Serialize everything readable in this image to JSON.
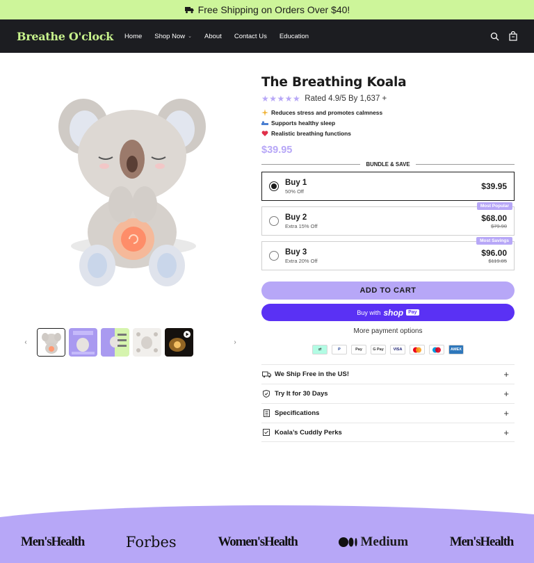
{
  "announcement": {
    "text": "Free Shipping on Orders Over $40!"
  },
  "header": {
    "logo": "Breathe O'clock",
    "nav": [
      "Home",
      "Shop Now",
      "About",
      "Contact Us",
      "Education"
    ]
  },
  "product": {
    "title": "The Breathing Koala",
    "rating_text": "Rated 4.9/5 By 1,637 +",
    "stars": "★★★★★",
    "benefits": [
      {
        "icon": "sparkle-icon",
        "text": "Reduces stress and promotes calmness"
      },
      {
        "icon": "sleep-icon",
        "text": "Supports healthy sleep"
      },
      {
        "icon": "heart-icon",
        "text": "Realistic breathing functions"
      }
    ],
    "price": "$39.95",
    "bundle_label": "BUNDLE & SAVE",
    "options": [
      {
        "title": "Buy 1",
        "subtitle": "50% Off",
        "price": "$39.95",
        "compare": "",
        "badge": "",
        "selected": true
      },
      {
        "title": "Buy 2",
        "subtitle": "Extra 15% Off",
        "price": "$68.00",
        "compare": "$79.90",
        "badge": "Most Popular",
        "selected": false
      },
      {
        "title": "Buy 3",
        "subtitle": "Extra 20% Off",
        "price": "$96.00",
        "compare": "$119.85",
        "badge": "Most Savings",
        "selected": false
      }
    ],
    "add_to_cart": "ADD TO CART",
    "shop_pay": {
      "prefix": "Buy with",
      "brand": "shop",
      "pay": "Pay"
    },
    "more_payment": "More payment options",
    "payment_methods": [
      "Afterpay",
      "PayPal",
      "Apple Pay",
      "G Pay",
      "VISA",
      "Mastercard",
      "Maestro",
      "AMEX"
    ],
    "accordion": [
      {
        "icon": "truck-icon",
        "label": "We Ship Free in the US!"
      },
      {
        "icon": "shield-check-icon",
        "label": "Try It for 30 Days"
      },
      {
        "icon": "document-icon",
        "label": "Specifications"
      },
      {
        "icon": "checkbox-icon",
        "label": "Koala’s Cuddly Perks"
      }
    ]
  },
  "press": [
    "Men'sHealth",
    "Forbes",
    "Women'sHealth",
    "Medium",
    "Men'sHealth"
  ],
  "colors": {
    "accent": "#b7a7f7",
    "announcement_bg": "#cdf59a",
    "header_bg": "#1c1d21",
    "shop_pay": "#5a31f4"
  }
}
